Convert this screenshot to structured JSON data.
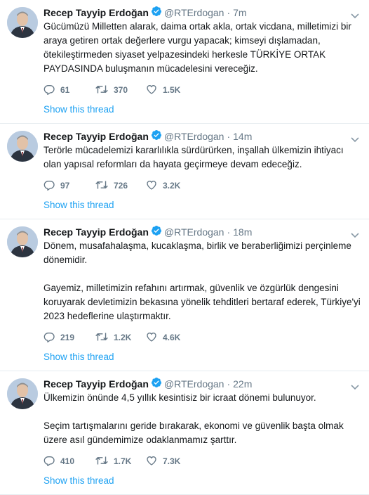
{
  "tweets": [
    {
      "name": "Recep Tayyip Erdoğan",
      "handle": "@RTErdogan",
      "separator": "·",
      "time": "7m",
      "paragraphs": [
        "Gücümüzü Milletten alarak, daima ortak akla, ortak vicdana, milletimizi bir araya getiren ortak değerlere vurgu yapacak; kimseyi dışlamadan, ötekileştirmeden siyaset yelpazesindeki herkesle  TÜRKİYE ORTAK PAYDASINDA buluşmanın mücadelesini vereceğiz."
      ],
      "replies": "61",
      "retweets": "370",
      "likes": "1.5K",
      "thread_link": "Show this thread"
    },
    {
      "name": "Recep Tayyip Erdoğan",
      "handle": "@RTErdogan",
      "separator": "·",
      "time": "14m",
      "paragraphs": [
        "Terörle mücadelemizi kararlılıkla sürdürürken, inşallah ülkemizin ihtiyacı olan yapısal reformları da hayata geçirmeye devam edeceğiz."
      ],
      "replies": "97",
      "retweets": "726",
      "likes": "3.2K",
      "thread_link": "Show this thread"
    },
    {
      "name": "Recep Tayyip Erdoğan",
      "handle": "@RTErdogan",
      "separator": "·",
      "time": "18m",
      "paragraphs": [
        "Dönem, musafahalaşma, kucaklaşma, birlik ve beraberliğimizi perçinleme dönemidir.",
        "Gayemiz, milletimizin refahını artırmak, güvenlik ve özgürlük dengesini koruyarak devletimizin bekasına yönelik tehditleri bertaraf ederek, Türkiye'yi 2023 hedeflerine ulaştırmaktır."
      ],
      "replies": "219",
      "retweets": "1.2K",
      "likes": "4.6K",
      "thread_link": "Show this thread"
    },
    {
      "name": "Recep Tayyip Erdoğan",
      "handle": "@RTErdogan",
      "separator": "·",
      "time": "22m",
      "paragraphs": [
        "Ülkemizin önünde 4,5 yıllık kesintisiz bir icraat dönemi bulunuyor.",
        "Seçim tartışmalarını geride bırakarak, ekonomi ve güvenlik başta olmak üzere asıl gündemimize odaklanmamız şarttır."
      ],
      "replies": "410",
      "retweets": "1.7K",
      "likes": "7.3K",
      "thread_link": "Show this thread"
    }
  ],
  "icons": {
    "avatar": "profile-photo",
    "verified": "verified-badge-icon",
    "caret": "chevron-down-icon",
    "reply": "reply-icon",
    "retweet": "retweet-icon",
    "like": "heart-icon"
  },
  "colors": {
    "link": "#1da1f2",
    "muted": "#657786",
    "text": "#14171a",
    "divider": "#e6ecf0"
  }
}
